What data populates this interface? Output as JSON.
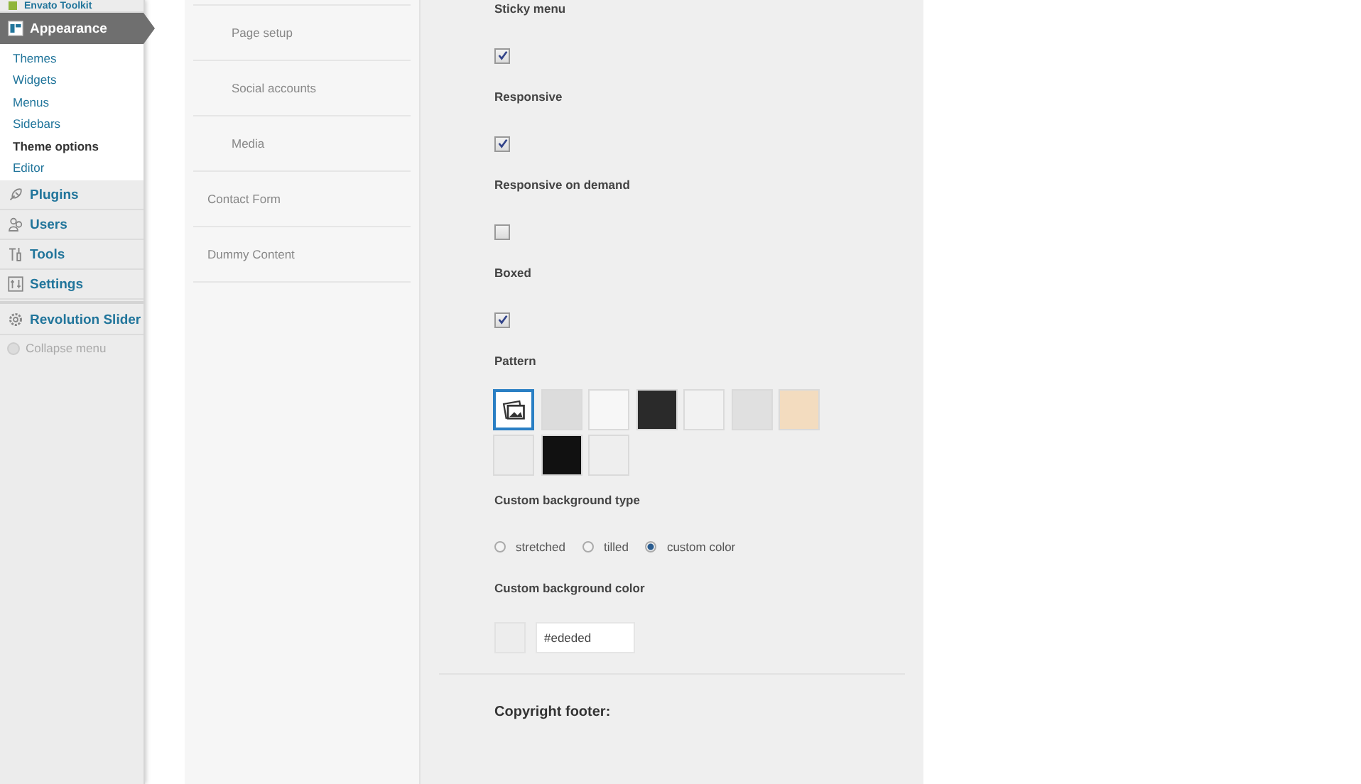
{
  "admin_menu": {
    "items": [
      {
        "label": "Envato Toolkit",
        "selected": false
      },
      {
        "label": "Appearance",
        "selected": true,
        "children": [
          {
            "label": "Themes",
            "selected": false
          },
          {
            "label": "Widgets",
            "selected": false
          },
          {
            "label": "Menus",
            "selected": false
          },
          {
            "label": "Sidebars",
            "selected": false
          },
          {
            "label": "Theme options",
            "selected": true
          },
          {
            "label": "Editor",
            "selected": false
          }
        ]
      },
      {
        "label": "Plugins",
        "selected": false
      },
      {
        "label": "Users",
        "selected": false
      },
      {
        "label": "Tools",
        "selected": false
      },
      {
        "label": "Settings",
        "selected": false
      },
      {
        "label": "Revolution Slider",
        "selected": false
      }
    ],
    "collapse": "Collapse menu"
  },
  "options_nav": [
    {
      "children": [
        {
          "label": "Page setup"
        },
        {
          "label": "Social accounts"
        },
        {
          "label": "Media"
        }
      ]
    },
    {
      "label": "Contact Form"
    },
    {
      "label": "Dummy Content"
    }
  ],
  "options": [
    {
      "kind": "checkbox",
      "label": "Sticky menu",
      "checked": true
    },
    {
      "kind": "checkbox",
      "label": "Responsive",
      "checked": true
    },
    {
      "kind": "checkbox",
      "label": "Responsive on demand",
      "checked": false
    },
    {
      "kind": "checkbox",
      "label": "Boxed",
      "checked": true
    },
    {
      "kind": "patterns",
      "label": "Pattern",
      "patterns": [
        {
          "kind": "image",
          "selected": true
        },
        {
          "kind": "swatch",
          "color": "#dcdcdc",
          "selected": false
        },
        {
          "kind": "swatch",
          "color": "#f7f7f7",
          "selected": false
        },
        {
          "kind": "swatch",
          "color": "#2a2a2a",
          "selected": false
        },
        {
          "kind": "swatch",
          "color": "#f2f2f2",
          "selected": false
        },
        {
          "kind": "swatch",
          "color": "#e0e0e0",
          "selected": false
        },
        {
          "kind": "swatch",
          "color": "#f3dcbf",
          "selected": false
        },
        {
          "kind": "swatch",
          "color": "#ebebeb",
          "selected": false
        },
        {
          "kind": "swatch",
          "color": "#111111",
          "selected": false
        },
        {
          "kind": "swatch",
          "color": "#eeeeee",
          "selected": false
        }
      ]
    },
    {
      "kind": "radio",
      "label": "Custom background type",
      "choices": [
        {
          "label": "stretched",
          "selected": false
        },
        {
          "label": "tilled",
          "selected": false
        },
        {
          "label": "custom color",
          "selected": true
        }
      ]
    },
    {
      "kind": "color",
      "label": "Custom background color",
      "value": "#ededed",
      "color": "#ededed"
    }
  ],
  "section_heading": "Copyright footer:"
}
